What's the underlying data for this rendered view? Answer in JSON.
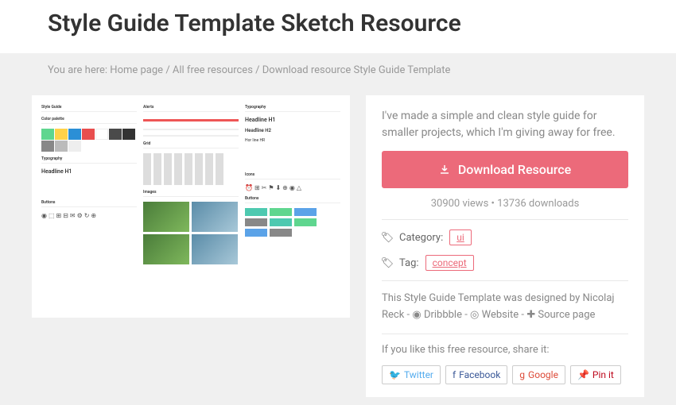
{
  "title": "Style Guide Template Sketch Resource",
  "breadcrumb": {
    "prefix": "You are here:",
    "home": "Home page",
    "all": "All free resources",
    "current": "Download resource Style Guide Template"
  },
  "description": "I've made a simple and clean style guide for smaller projects, which I'm giving away for free.",
  "download_btn": "Download Resource",
  "stats": {
    "views": "30900 views",
    "sep": "•",
    "downloads": "13736 downloads"
  },
  "category": {
    "label": "Category:",
    "value": "ui"
  },
  "tag": {
    "label": "Tag:",
    "value": "concept"
  },
  "credit": {
    "prefix": "This Style Guide Template was designed by ",
    "author": "Nicolaj Reck",
    "dribbble": "Dribbble",
    "website": "Website",
    "source": "Source page"
  },
  "share": {
    "label": "If you like this free resource, share it:",
    "twitter": "Twitter",
    "facebook": "Facebook",
    "google": "Google",
    "pinterest": "Pin it"
  },
  "preview": {
    "style_guide": "Style Guide",
    "color_palette": "Color palette",
    "typography": "Typography",
    "headline1": "Headline H1",
    "headline2": "Headline H2",
    "icons": "Icons",
    "buttons": "Buttons",
    "alerts": "Alerts",
    "grid": "Grid",
    "images": "Images",
    "hr": "Hor line HR"
  }
}
